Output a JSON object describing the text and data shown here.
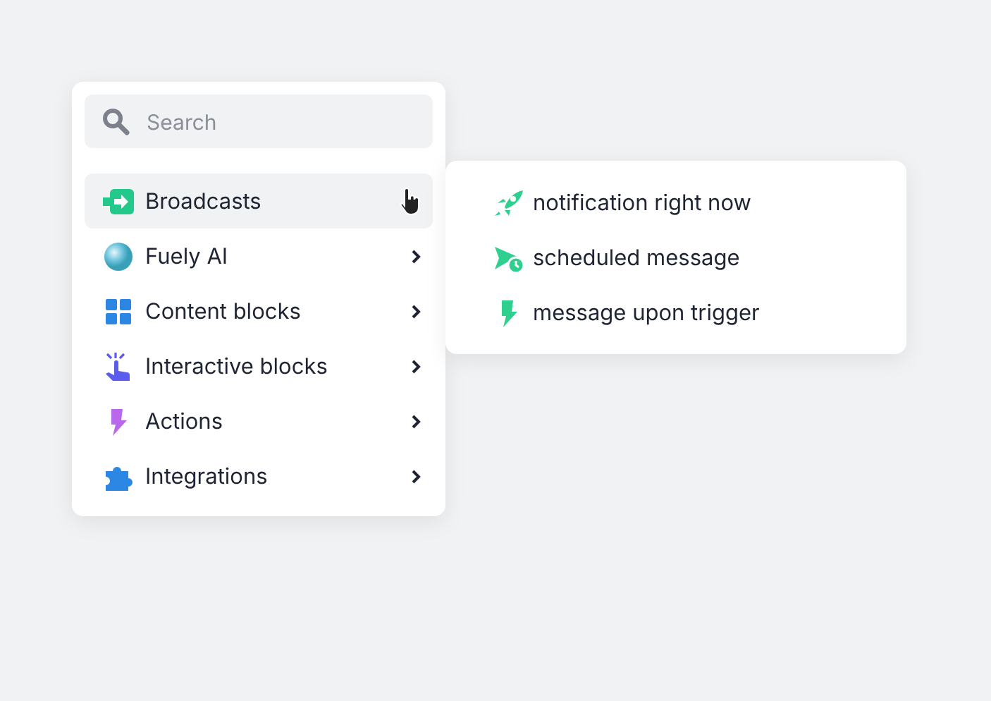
{
  "search": {
    "placeholder": "Search"
  },
  "menu": [
    {
      "label": "Broadcasts",
      "kind": "broadcast",
      "selected": true
    },
    {
      "label": "Fuely AI",
      "kind": "orb",
      "selected": false
    },
    {
      "label": "Content blocks",
      "kind": "grid",
      "selected": false
    },
    {
      "label": "Interactive blocks",
      "kind": "tap",
      "selected": false
    },
    {
      "label": "Actions",
      "kind": "bolt",
      "selected": false
    },
    {
      "label": "Integrations",
      "kind": "puzzle",
      "selected": false
    }
  ],
  "submenu": [
    {
      "label": "notification right now",
      "kind": "rocket"
    },
    {
      "label": "scheduled message",
      "kind": "scheduled"
    },
    {
      "label": "message upon trigger",
      "kind": "trigger"
    }
  ]
}
